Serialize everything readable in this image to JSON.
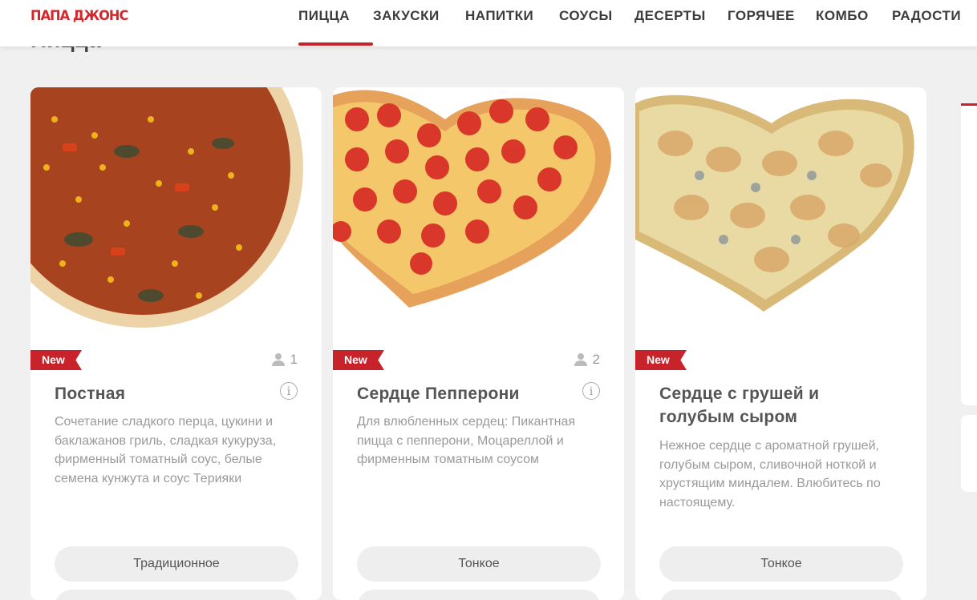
{
  "header": {
    "logo": "ПАПА ДЖОНС",
    "nav": [
      "ПИЦЦА",
      "ЗАКУСКИ",
      "НАПИТКИ",
      "СОУСЫ",
      "ДЕСЕРТЫ",
      "ГОРЯЧЕЕ",
      "КОМБО",
      "РАДОСТИ"
    ],
    "active_index": 0
  },
  "page": {
    "title": "Пицца"
  },
  "colors": {
    "brand": "#c8232a",
    "nav_text": "#3b3b3b"
  },
  "products": [
    {
      "badge": "New",
      "persons": "1",
      "name": "Постная",
      "description": "Сочетание сладкого перца, цукини и баклажанов гриль, сладкая кукуруза, фирменный томатный соус, белые семена кунжута и соус Терияки",
      "dough": "Традиционное",
      "image": "round-veggie-pizza"
    },
    {
      "badge": "New",
      "persons": "2",
      "name": "Сердце Пепперони",
      "description": "Для влюбленных сердец: Пикантная пицца с пепперони, Моцареллой и фирменным томатным соусом",
      "dough": "Тонкое",
      "image": "heart-pepperoni-pizza"
    },
    {
      "badge": "New",
      "persons": "",
      "name": "Сердце с грушей и голубым сыром",
      "description": "Нежное сердце с ароматной грушей, голубым сыром, сливочной ноткой и хрустящим миндалем. Влюбитесь по настоящему.",
      "dough": "Тонкое",
      "image": "heart-pear-blue-cheese-pizza"
    }
  ]
}
